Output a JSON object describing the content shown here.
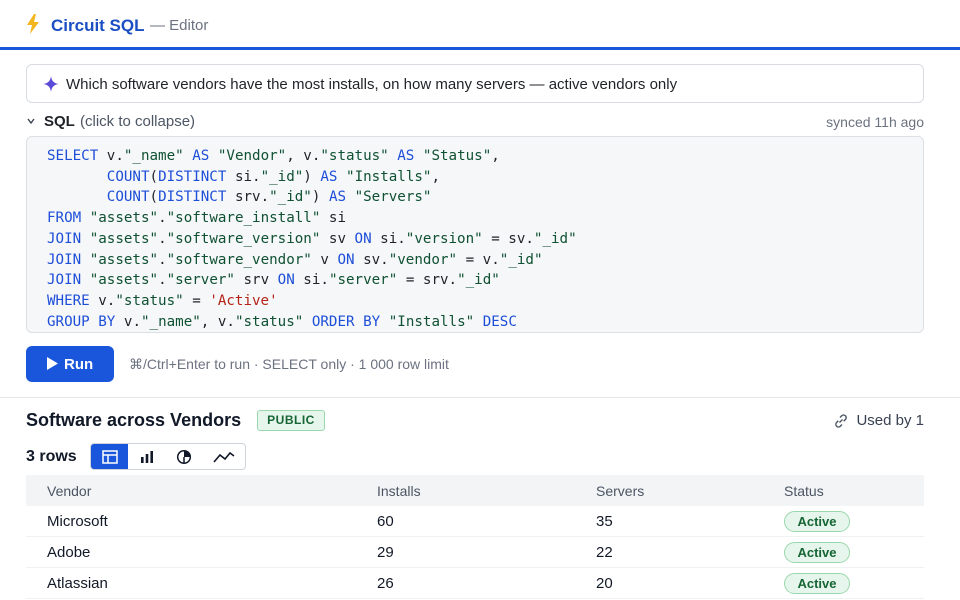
{
  "header": {
    "app_name": "Circuit SQL",
    "subtitle": "— Editor",
    "accent": "#1a56db"
  },
  "prompt": {
    "icon": "sparkle-icon",
    "text": "Which software vendors have the most installs, on how many servers — active vendors only"
  },
  "sql": {
    "label": "SQL",
    "hint": "(click to collapse)",
    "synced": "synced 11h ago",
    "lines": [
      "SELECT v.\"_name\" AS \"Vendor\", v.\"status\" AS \"Status\",",
      "       COUNT(DISTINCT si.\"_id\") AS \"Installs\",",
      "       COUNT(DISTINCT srv.\"_id\") AS \"Servers\"",
      "FROM \"assets\".\"software_install\" si",
      "JOIN \"assets\".\"software_version\" sv ON si.\"version\" = sv.\"_id\"",
      "JOIN \"assets\".\"software_vendor\" v ON sv.\"vendor\" = v.\"_id\"",
      "JOIN \"assets\".\"server\" srv ON si.\"server\" = srv.\"_id\"",
      "WHERE v.\"status\" = 'Active'",
      "GROUP BY v.\"_name\", v.\"status\" ORDER BY \"Installs\" DESC"
    ]
  },
  "run": {
    "label": "Run",
    "hint": "⌘/Ctrl+Enter to run · SELECT only · 1 000 row limit"
  },
  "results": {
    "title": "Software across Vendors",
    "badge": "PUBLIC",
    "used_by": "Used by 1",
    "row_count": "3 rows",
    "views": [
      "table-view-icon",
      "bar-chart-icon",
      "pie-chart-icon",
      "line-chart-icon"
    ],
    "active_view": "table-view-icon",
    "columns": [
      "Vendor",
      "Installs",
      "Servers",
      "Status"
    ],
    "rows": [
      {
        "vendor": "Microsoft",
        "installs": "60",
        "servers": "35",
        "status": "Active"
      },
      {
        "vendor": "Adobe",
        "installs": "29",
        "servers": "22",
        "status": "Active"
      },
      {
        "vendor": "Atlassian",
        "installs": "26",
        "servers": "20",
        "status": "Active"
      }
    ]
  }
}
